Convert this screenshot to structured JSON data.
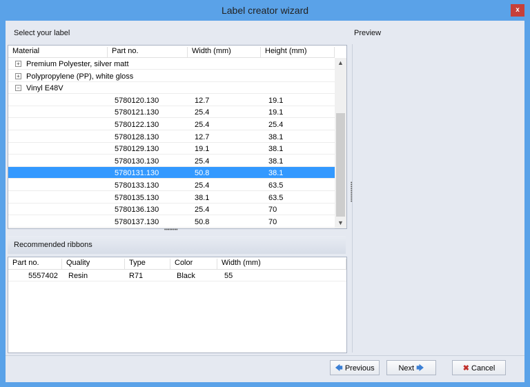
{
  "window": {
    "title": "Label creator wizard",
    "close_label": "x"
  },
  "label_section": {
    "title": "Select your label"
  },
  "preview": {
    "title": "Preview"
  },
  "label_table": {
    "columns": [
      "Material",
      "Part no.",
      "Width (mm)",
      "Height (mm)"
    ],
    "groups": [
      {
        "name": "Premium Polyester, silver matt",
        "expander": "+"
      },
      {
        "name": "Polypropylene (PP), white gloss",
        "expander": "+"
      },
      {
        "name": "Vinyl E48V",
        "expander": "−"
      }
    ],
    "rows": [
      {
        "part": "5780120.130",
        "width": "12.7",
        "height": "19.1"
      },
      {
        "part": "5780121.130",
        "width": "25.4",
        "height": "19.1"
      },
      {
        "part": "5780122.130",
        "width": "25.4",
        "height": "25.4"
      },
      {
        "part": "5780128.130",
        "width": "12.7",
        "height": "38.1"
      },
      {
        "part": "5780129.130",
        "width": "19.1",
        "height": "38.1"
      },
      {
        "part": "5780130.130",
        "width": "25.4",
        "height": "38.1"
      },
      {
        "part": "5780131.130",
        "width": "50.8",
        "height": "38.1"
      },
      {
        "part": "5780133.130",
        "width": "25.4",
        "height": "63.5"
      },
      {
        "part": "5780135.130",
        "width": "38.1",
        "height": "63.5"
      },
      {
        "part": "5780136.130",
        "width": "25.4",
        "height": "70"
      },
      {
        "part": "5780137.130",
        "width": "50.8",
        "height": "70"
      }
    ]
  },
  "ribbons": {
    "title": "Recommended ribbons",
    "columns": [
      "Part no.",
      "Quality",
      "Type",
      "Color",
      "Width (mm)"
    ],
    "rows": [
      {
        "part": "5557402",
        "quality": "Resin",
        "type": "R71",
        "color": "Black",
        "width": "55"
      }
    ]
  },
  "buttons": {
    "previous": "Previous",
    "next": "Next",
    "cancel": "Cancel"
  },
  "icons": {
    "previous": "arrow-left-icon",
    "next": "arrow-right-icon",
    "cancel": "x-mark-icon"
  },
  "colors": {
    "selection": "#3399ff",
    "titlebar": "#5aa2e8",
    "close": "#c7403a"
  }
}
